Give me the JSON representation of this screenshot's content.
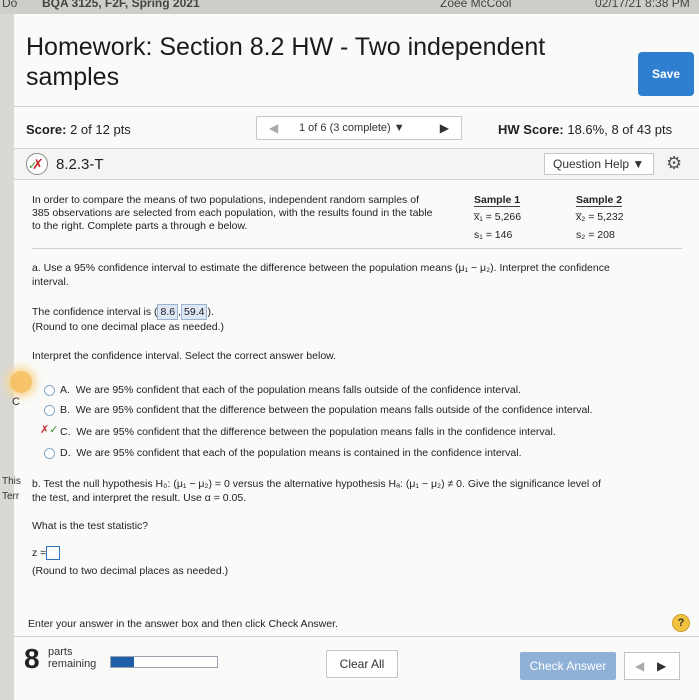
{
  "browser": {
    "tab_title": "BQA 3125, F2F, Spring 2021",
    "user": "Zoee McCool",
    "datetime": "02/17/21 8:38 PM",
    "left_fragment": "Do"
  },
  "header": {
    "title": "Homework: Section 8.2 HW - Two independent samples",
    "save_label": "Save"
  },
  "score_bar": {
    "score_label": "Score:",
    "score_value": "2 of 12 pts",
    "prev_icon": "triangle-left",
    "progress_text": "1 of 6 (3 complete)",
    "dropdown_icon": "triangle-down",
    "next_icon": "triangle-right",
    "hw_score_label": "HW Score:",
    "hw_score_value": "18.6%, 8 of 43 pts"
  },
  "question": {
    "id": "8.2.3-T",
    "help_label": "Question Help",
    "help_caret": "▼",
    "gear_icon": "⚙"
  },
  "problem": {
    "intro_line1": "In order to compare the means of two populations, independent random samples of",
    "intro_line2": "385 observations are selected from each population, with the results found in the table",
    "intro_line3": "to the right. Complete parts a through e below.",
    "sample1_header": "Sample 1",
    "sample2_header": "Sample 2",
    "sample1_mean": "x̅₁ = 5,266",
    "sample2_mean": "x̅₂ = 5,232",
    "sample1_sd": "s₁ = 146",
    "sample2_sd": "s₂ = 208"
  },
  "part_a": {
    "prompt_line1": "a. Use a 95% confidence interval to estimate the difference between the population means (μ₁ − μ₂). Interpret the confidence",
    "prompt_line2": "interval.",
    "ci_prefix": "The confidence interval is (",
    "ci_low": "8.6",
    "ci_sep": ",",
    "ci_high": "59.4",
    "ci_suffix": ").",
    "round_note": "(Round to one decimal place as needed.)",
    "interpret_prompt": "Interpret the confidence interval. Select the correct answer below.",
    "options": [
      {
        "letter": "A.",
        "text": "We are 95% confident that each of the population means falls outside of the confidence interval."
      },
      {
        "letter": "B.",
        "text": "We are 95% confident that the difference between the population means falls outside of the confidence interval."
      },
      {
        "letter": "C.",
        "text": "We are 95% confident that the difference between the population means falls in the confidence interval."
      },
      {
        "letter": "D.",
        "text": "We are 95% confident that each of the population means is contained in the confidence interval."
      }
    ]
  },
  "part_b": {
    "prompt_line1": "b. Test the null hypothesis H₀: (μ₁ − μ₂) = 0 versus the alternative hypothesis Hₐ: (μ₁ − μ₂) ≠ 0. Give the significance level of",
    "prompt_line2": "the test, and interpret the result. Use α = 0.05.",
    "stat_prompt": "What is the test statistic?",
    "z_label": "z =",
    "round_note": "(Round to two decimal places as needed.)"
  },
  "footer": {
    "instruction": "Enter your answer in the answer box and then click Check Answer.",
    "help_symbol": "?",
    "parts_count": "8",
    "parts_label1": "parts",
    "parts_label2": "remaining",
    "progress_fraction": 0.22,
    "clear_label": "Clear All",
    "check_label": "Check Answer"
  },
  "left_edge": {
    "c_fragment": "C",
    "this_fragment": "This",
    "terr_fragment": "Terr"
  }
}
